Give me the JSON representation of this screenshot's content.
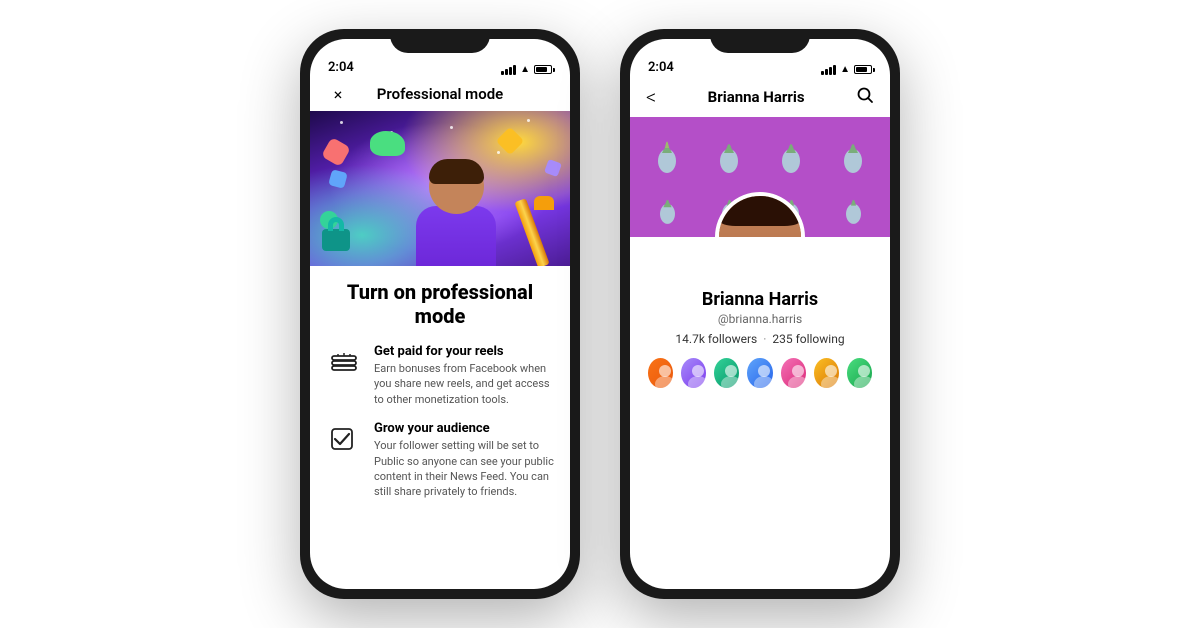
{
  "scene": {
    "background": "#ffffff"
  },
  "phone1": {
    "time": "2:04",
    "header_title": "Professional mode",
    "close_btn": "×",
    "main_heading": "Turn on professional mode",
    "features": [
      {
        "icon": "money-stack-icon",
        "title": "Get paid for your reels",
        "description": "Earn bonuses from Facebook when you share new reels, and get access to other monetization tools."
      },
      {
        "icon": "audience-icon",
        "title": "Grow your audience",
        "description": "Your follower setting will be set to Public so anyone can see your public content in their News Feed. You can still share privately to friends."
      }
    ]
  },
  "phone2": {
    "time": "2:04",
    "back_btn": "<",
    "profile_name_header": "Brianna Harris",
    "search_btn": "🔍",
    "cover_items": [
      "🍍",
      "🍍",
      "🍍",
      "🍍",
      "🍍",
      "🍍",
      "🍍",
      "🍍"
    ],
    "profile": {
      "name": "Brianna Harris",
      "handle": "@brianna.harris",
      "followers": "14.7k followers",
      "dot": "·",
      "following": "235 following"
    },
    "friends": [
      "fa1",
      "fa2",
      "fa3",
      "fa4",
      "fa5",
      "fa6",
      "fa7"
    ]
  }
}
